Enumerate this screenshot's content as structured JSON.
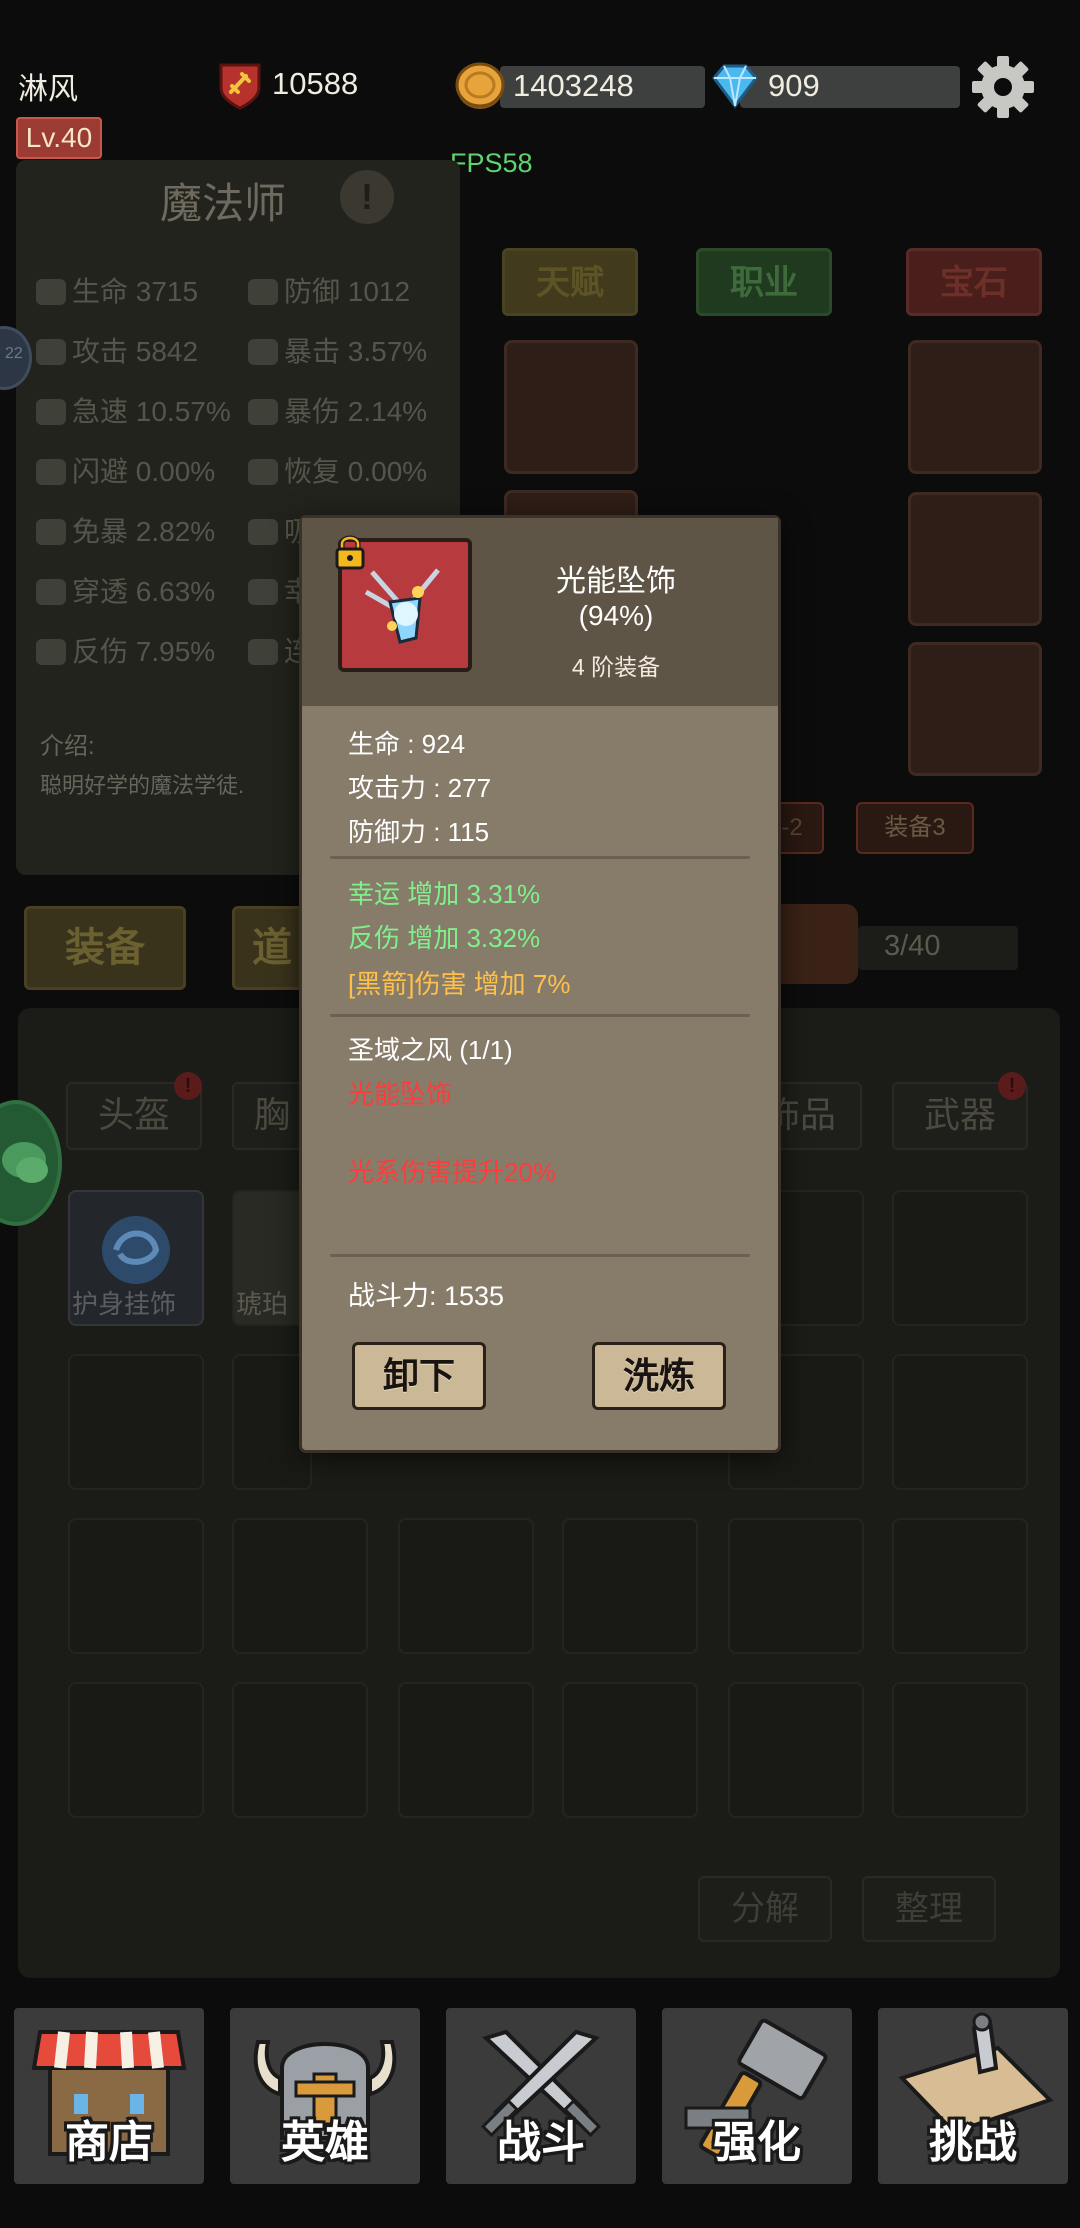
{
  "player": {
    "name": "淋风",
    "level": "Lv.40",
    "power": "10588",
    "gold": "1403248",
    "gems": "909"
  },
  "fps": "FPS58",
  "hero_panel": {
    "class_name": "魔法师",
    "info_icon": "!",
    "stats": [
      {
        "label": "生命 3715",
        "icon": "heart-icon"
      },
      {
        "label": "防御 1012",
        "icon": "shield-icon"
      },
      {
        "label": "攻击 5842",
        "icon": "sword-icon"
      },
      {
        "label": "暴击 3.57%",
        "icon": "fire-icon"
      },
      {
        "label": "急速 10.57%",
        "icon": "speed-icon"
      },
      {
        "label": "暴伤 2.14%",
        "icon": "crit-damage-icon"
      },
      {
        "label": "闪避 0.00%",
        "icon": "dodge-icon"
      },
      {
        "label": "恢复 0.00%",
        "icon": "heal-icon"
      },
      {
        "label": "免暴 2.82%",
        "icon": "anti-crit-icon"
      },
      {
        "label": "吸",
        "icon": "lifesteal-icon"
      },
      {
        "label": "穿透 6.63%",
        "icon": "pierce-icon"
      },
      {
        "label": "幸",
        "icon": "luck-icon"
      },
      {
        "label": "反伤 7.95%",
        "icon": "reflect-icon"
      },
      {
        "label": "连",
        "icon": "combo-icon"
      }
    ],
    "intro_label": "介绍:",
    "intro_text": "聪明好学的魔法学徒."
  },
  "left_avatar_badge": "22",
  "top_tabs": {
    "talent": "天赋",
    "class": "职业",
    "gem": "宝石"
  },
  "equip_tags": {
    "tag2": "-2",
    "tag3": "装备3"
  },
  "main_tabs": {
    "equip": "装备",
    "items": "道"
  },
  "bag_count": "3/40",
  "categories": {
    "helmet": "头盔",
    "chest": "胸",
    "accessory": "饰品",
    "weapon": "武器",
    "badge": "!"
  },
  "inventory_items": [
    {
      "label": "护身挂饰",
      "icon": "amulet-icon"
    },
    {
      "label": "琥珀",
      "icon": "amber-icon"
    }
  ],
  "inventory_buttons": {
    "decompose": "分解",
    "sort": "整理"
  },
  "nav": [
    {
      "label": "商店",
      "icon": "shop-icon"
    },
    {
      "label": "英雄",
      "icon": "helmet-icon"
    },
    {
      "label": "战斗",
      "icon": "crossed-swords-icon"
    },
    {
      "label": "强化",
      "icon": "hammer-icon"
    },
    {
      "label": "挑战",
      "icon": "challenge-map-icon"
    }
  ],
  "item_detail": {
    "name": "光能坠饰",
    "quality": "(94%)",
    "tier": "4 阶装备",
    "base_stats": [
      "生命 : 924",
      "攻击力 : 277",
      "防御力 : 115"
    ],
    "bonus_stats": [
      "幸运 增加 3.31%",
      "反伤 增加 3.32%"
    ],
    "special_stat": "[黑箭]伤害 增加 7%",
    "set_name": "圣域之风 (1/1)",
    "set_piece": "光能坠饰",
    "set_bonus": "光系伤害提升20%",
    "combat_power": "战斗力: 1535",
    "unequip_label": "卸下",
    "refine_label": "洗炼"
  },
  "colors": {
    "bonus_green": "#7ff08a",
    "special_gold": "#ffc04a",
    "set_red": "#ff3b3b",
    "item_bg": "#b73a3e",
    "modal_bg": "#877c6a",
    "fps_green": "#5fd36e"
  }
}
